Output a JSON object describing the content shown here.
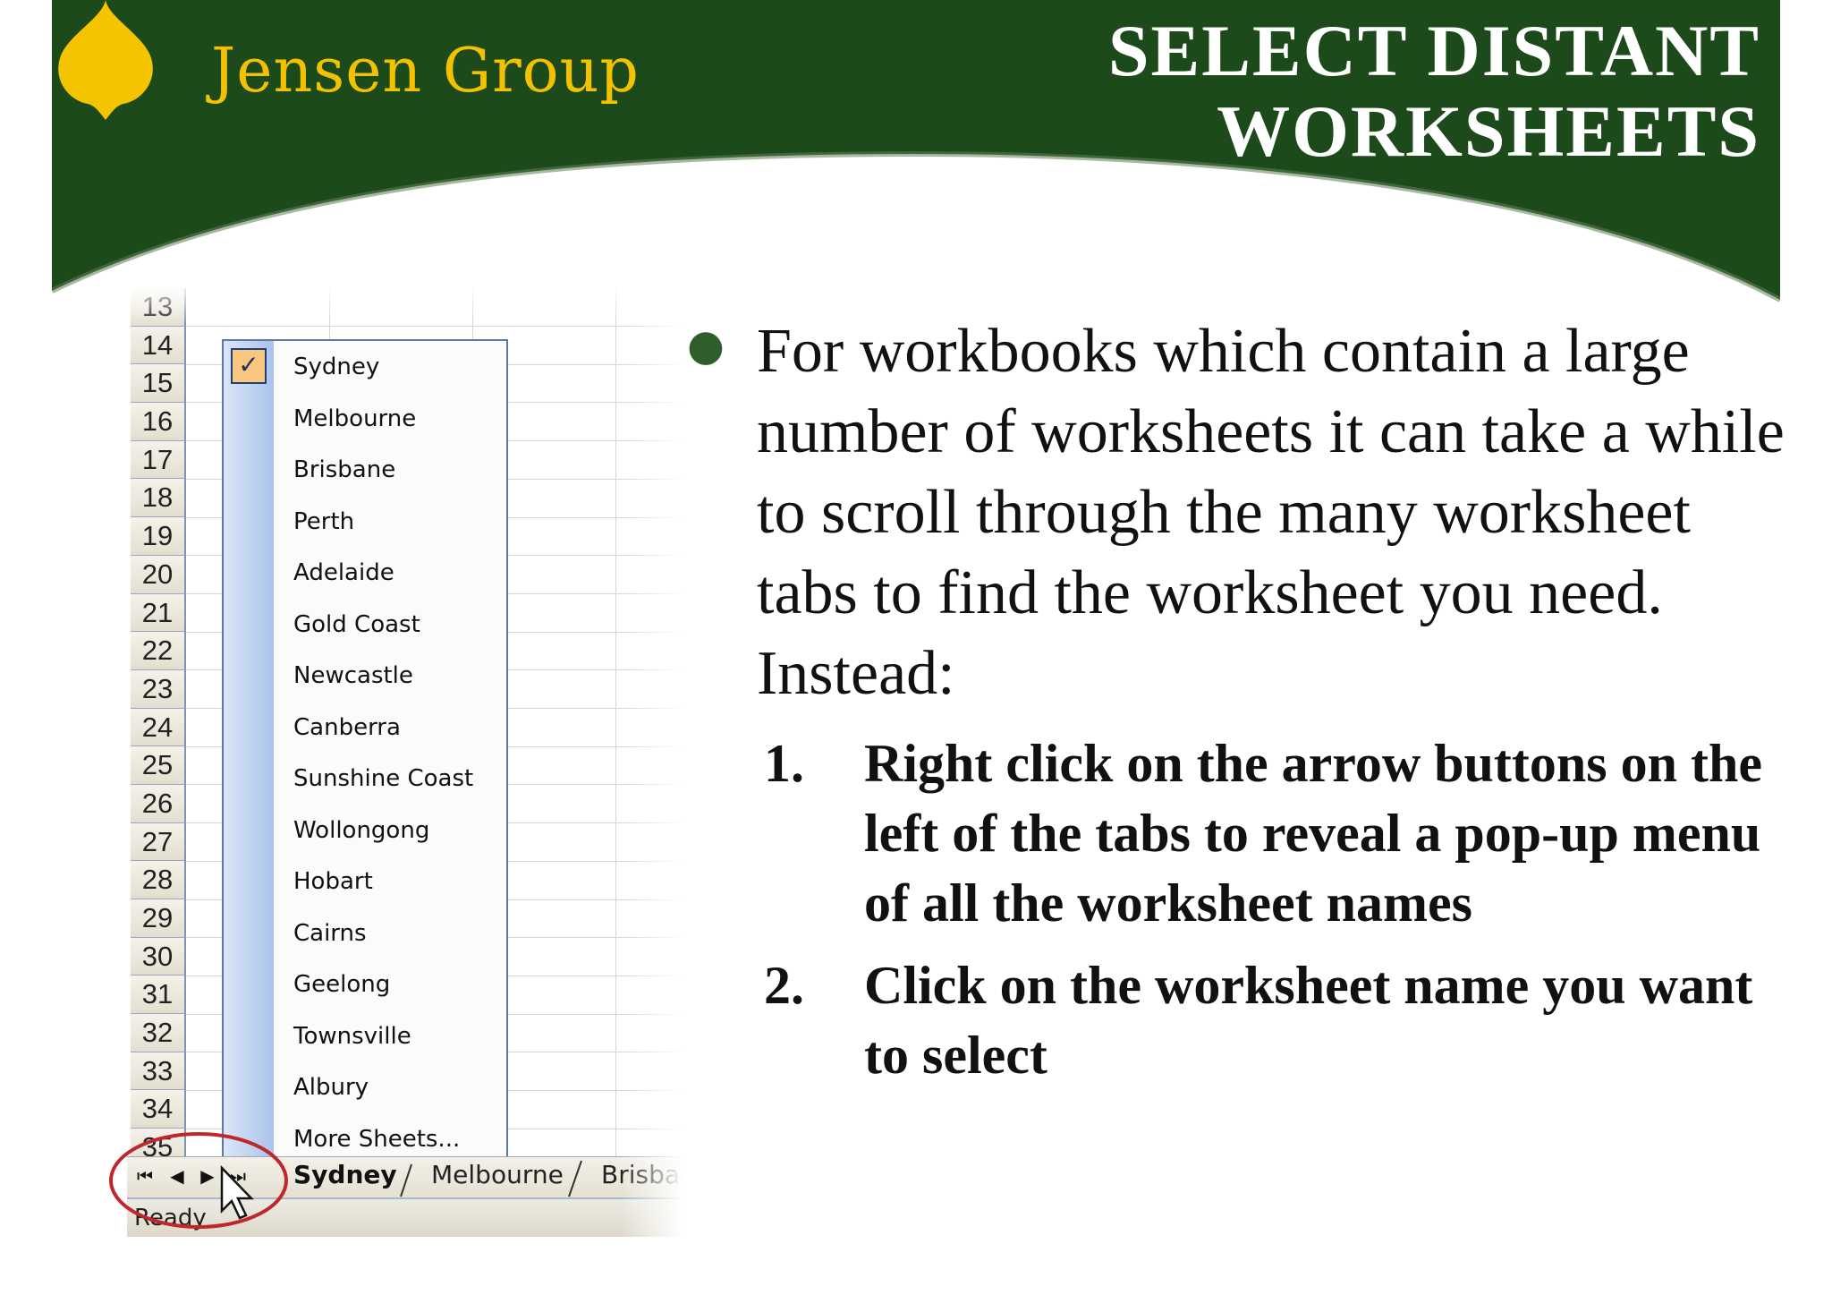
{
  "header": {
    "brand": "Jensen Group",
    "title_line1": "SELECT DISTANT",
    "title_line2": "WORKSHEETS",
    "colors": {
      "banner": "#1d4a1a",
      "brand": "#f2c200",
      "logo": "#f5c400"
    }
  },
  "spreadsheet": {
    "row_numbers": [
      "13",
      "14",
      "15",
      "16",
      "17",
      "18",
      "19",
      "20",
      "21",
      "22",
      "23",
      "24",
      "25",
      "26",
      "27",
      "28",
      "29",
      "30",
      "31",
      "32",
      "33",
      "34",
      "35"
    ],
    "menu": {
      "items": [
        {
          "label": "Sydney",
          "checked": true
        },
        {
          "label": "Melbourne"
        },
        {
          "label": "Brisbane"
        },
        {
          "label": "Perth"
        },
        {
          "label": "Adelaide"
        },
        {
          "label": "Gold Coast"
        },
        {
          "label": "Newcastle"
        },
        {
          "label": "Canberra"
        },
        {
          "label": "Sunshine Coast"
        },
        {
          "label": "Wollongong"
        },
        {
          "label": "Hobart"
        },
        {
          "label": "Cairns"
        },
        {
          "label": "Geelong"
        },
        {
          "label": "Townsville"
        },
        {
          "label": "Albury"
        },
        {
          "label": "More Sheets..."
        }
      ]
    },
    "tabs": [
      "Sydney",
      "Melbourne",
      "Brisbar"
    ],
    "nav_buttons": {
      "first": "⏮",
      "prev": "◀",
      "next": "▶",
      "last": "⏭"
    },
    "status": "Ready",
    "annotation_color": "#c0262c"
  },
  "content": {
    "lead": "For workbooks which contain a large number of worksheets it can take a while to scroll through the many worksheet tabs to find the worksheet you need. Instead:",
    "steps": [
      {
        "num": "1.",
        "text": "Right click on the arrow buttons on the left of the tabs to reveal a pop-up menu of all the worksheet names"
      },
      {
        "num": "2.",
        "text": "Click on the worksheet name you want to select"
      }
    ]
  }
}
